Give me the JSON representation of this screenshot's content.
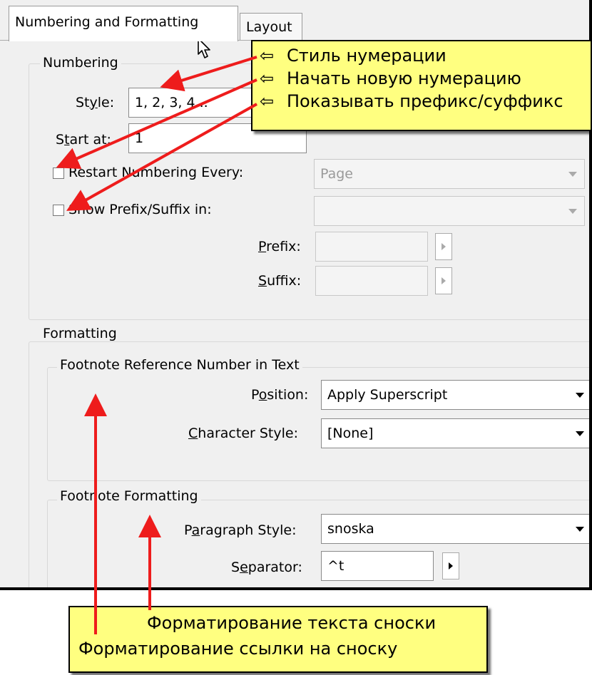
{
  "tabs": {
    "active": "Numbering and Formatting",
    "layout": "Layout"
  },
  "numbering": {
    "group_label": "Numbering",
    "style_label_pre": "St",
    "style_label_u": "y",
    "style_label_post": "le:",
    "style_value": "1, 2, 3, 4...",
    "start_label_pre": "S",
    "start_label_u": "t",
    "start_label_post": "art at:",
    "start_value": "1",
    "restart_label": "Restart Numbering Every:",
    "restart_value": "Page",
    "prefix_suffix_label": "Show Prefix/Suffix in:",
    "prefix_label_u": "P",
    "prefix_label_post": "refix:",
    "suffix_label_u": "S",
    "suffix_label_post": "uffix:"
  },
  "formatting": {
    "group_label": "Formatting",
    "ref_group_label": "Footnote Reference Number in Text",
    "position_label_pre": "P",
    "position_label_u": "o",
    "position_label_post": "sition:",
    "position_value": "Apply Superscript",
    "charstyle_label_u": "C",
    "charstyle_label_post": "haracter Style:",
    "charstyle_value": "[None]",
    "fn_group_label": "Footnote Formatting",
    "parstyle_label_pre": "P",
    "parstyle_label_u": "a",
    "parstyle_label_post": "ragraph Style:",
    "parstyle_value": "snoska",
    "separator_label_pre": "S",
    "separator_label_u": "e",
    "separator_label_post": "parator:",
    "separator_value": "^t"
  },
  "callout_top": {
    "arrow_glyph": "⇦",
    "line1": "Стиль нумерации",
    "line2": "Начать новую нумерацию",
    "line3": "Показывать префикс/суффикс"
  },
  "callout_bottom": {
    "line1": "Форматирование текста сноски",
    "line2": "Форматирование ссылки на сноску"
  },
  "colors": {
    "callout_bg": "#ffff80",
    "arrow": "#ee1c1c",
    "panel_bg": "#f0f0f0"
  }
}
